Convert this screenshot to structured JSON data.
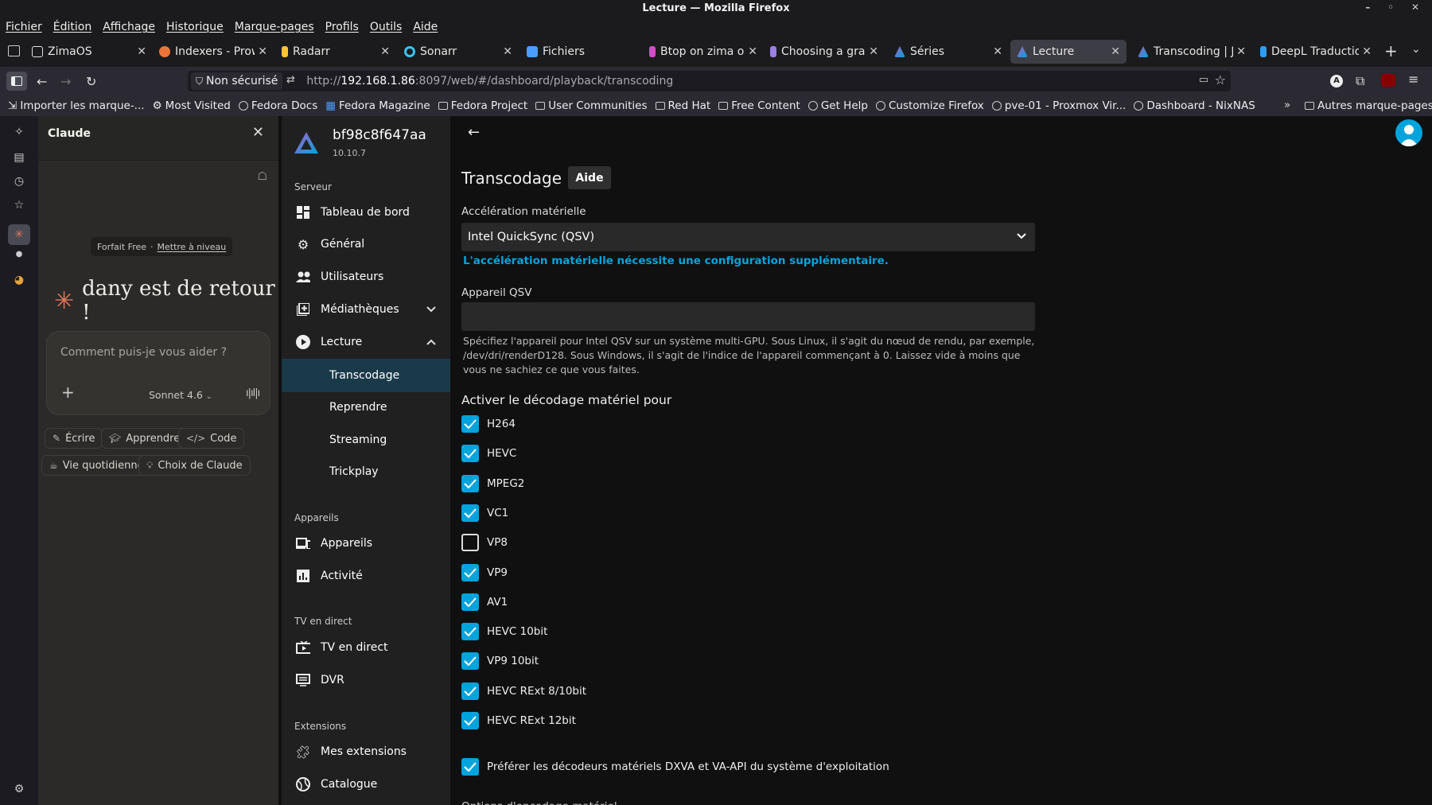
{
  "window": {
    "title": "Lecture — Mozilla Firefox"
  },
  "menubar": [
    "Fichier",
    "Édition",
    "Affichage",
    "Historique",
    "Marque-pages",
    "Profils",
    "Outils",
    "Aide"
  ],
  "tabs": [
    {
      "label": "ZimaOS",
      "color": "#e0e0e0",
      "active": false
    },
    {
      "label": "Indexers - Prowl",
      "color": "#e8763a",
      "active": false
    },
    {
      "label": "Radarr",
      "color": "#ffc230",
      "active": false
    },
    {
      "label": "Sonarr",
      "color": "#35c5f4",
      "active": false
    },
    {
      "label": "Fichiers",
      "color": "#4a9eff",
      "active": false
    },
    {
      "label": "Btop on zima os",
      "color": "#d04fc8",
      "active": false
    },
    {
      "label": "Choosing a grap",
      "color": "#9b7fe6",
      "active": false
    },
    {
      "label": "Séries",
      "color": "#aa5cc3",
      "active": false
    },
    {
      "label": "Lecture",
      "color": "#aa5cc3",
      "active": true
    },
    {
      "label": "Transcoding | Je",
      "color": "#aa5cc3",
      "active": false
    },
    {
      "label": "DeepL Traductio",
      "color": "#2e9cf2",
      "active": false
    }
  ],
  "urlbar": {
    "security": "Non sécurisé",
    "url_scheme": "http://",
    "url_host": "192.168.1.86",
    "url_path": ":8097/web/#/dashboard/playback/transcoding"
  },
  "bookmarks": [
    "Importer les marque-...",
    "Most Visited",
    "Fedora Docs",
    "Fedora Magazine",
    "Fedora Project",
    "User Communities",
    "Red Hat",
    "Free Content",
    "Get Help",
    "Customize Firefox",
    "pve-01 - Proxmox Vir...",
    "Dashboard - NixNAS"
  ],
  "bookmarks_other": "Autres marque-pages",
  "claude": {
    "title": "Claude",
    "plan": "Forfait Free",
    "upgrade": "Mettre à niveau",
    "greeting": "dany est de retour !",
    "placeholder": "Comment puis-je vous aider ?",
    "model": "Sonnet 4.6",
    "chips": [
      "Écrire",
      "Apprendre",
      "Code",
      "Vie quotidienne",
      "Choix de Claude"
    ]
  },
  "jellyfin": {
    "server_name": "bf98c8f647aa",
    "version": "10.10.7",
    "sections": {
      "server": "Serveur",
      "devices": "Appareils",
      "livetv": "TV en direct",
      "extensions": "Extensions"
    },
    "nav": {
      "dashboard": "Tableau de bord",
      "general": "Général",
      "users": "Utilisateurs",
      "libraries": "Médiathèques",
      "playback": "Lecture",
      "transcoding": "Transcodage",
      "resume": "Reprendre",
      "streaming": "Streaming",
      "trickplay": "Trickplay",
      "devices": "Appareils",
      "activity": "Activité",
      "livetv": "TV en direct",
      "dvr": "DVR",
      "my_plugins": "Mes extensions",
      "catalog": "Catalogue"
    },
    "accent": "#00a4dc"
  },
  "page": {
    "title": "Transcodage",
    "help_button": "Aide",
    "hw_accel_label": "Accélération matérielle",
    "hw_accel_value": "Intel QuickSync (QSV)",
    "hw_accel_link": "L'accélération matérielle nécessite une configuration supplémentaire.",
    "qsv_device_label": "Appareil QSV",
    "qsv_device_value": "",
    "qsv_help": "Spécifiez l'appareil pour Intel QSV sur un système multi-GPU. Sous Linux, il s'agit du nœud de rendu, par exemple, /dev/dri/renderD128. Sous Windows, il s'agit de l'indice de l'appareil commençant à 0. Laissez vide à moins que vous ne sachiez ce que vous faites.",
    "decode_heading": "Activer le décodage matériel pour",
    "codecs": [
      {
        "label": "H264",
        "checked": true
      },
      {
        "label": "HEVC",
        "checked": true
      },
      {
        "label": "MPEG2",
        "checked": true
      },
      {
        "label": "VC1",
        "checked": true
      },
      {
        "label": "VP8",
        "checked": false
      },
      {
        "label": "VP9",
        "checked": true
      },
      {
        "label": "AV1",
        "checked": true
      },
      {
        "label": "HEVC 10bit",
        "checked": true
      },
      {
        "label": "VP9 10bit",
        "checked": true
      },
      {
        "label": "HEVC RExt 8/10bit",
        "checked": true
      },
      {
        "label": "HEVC RExt 12bit",
        "checked": true
      }
    ],
    "prefer_os_decoders": {
      "label": "Préférer les décodeurs matériels DXVA et VA-API du système d'exploitation",
      "checked": true
    },
    "next_section_cut": "Options d'encodage matériel"
  }
}
